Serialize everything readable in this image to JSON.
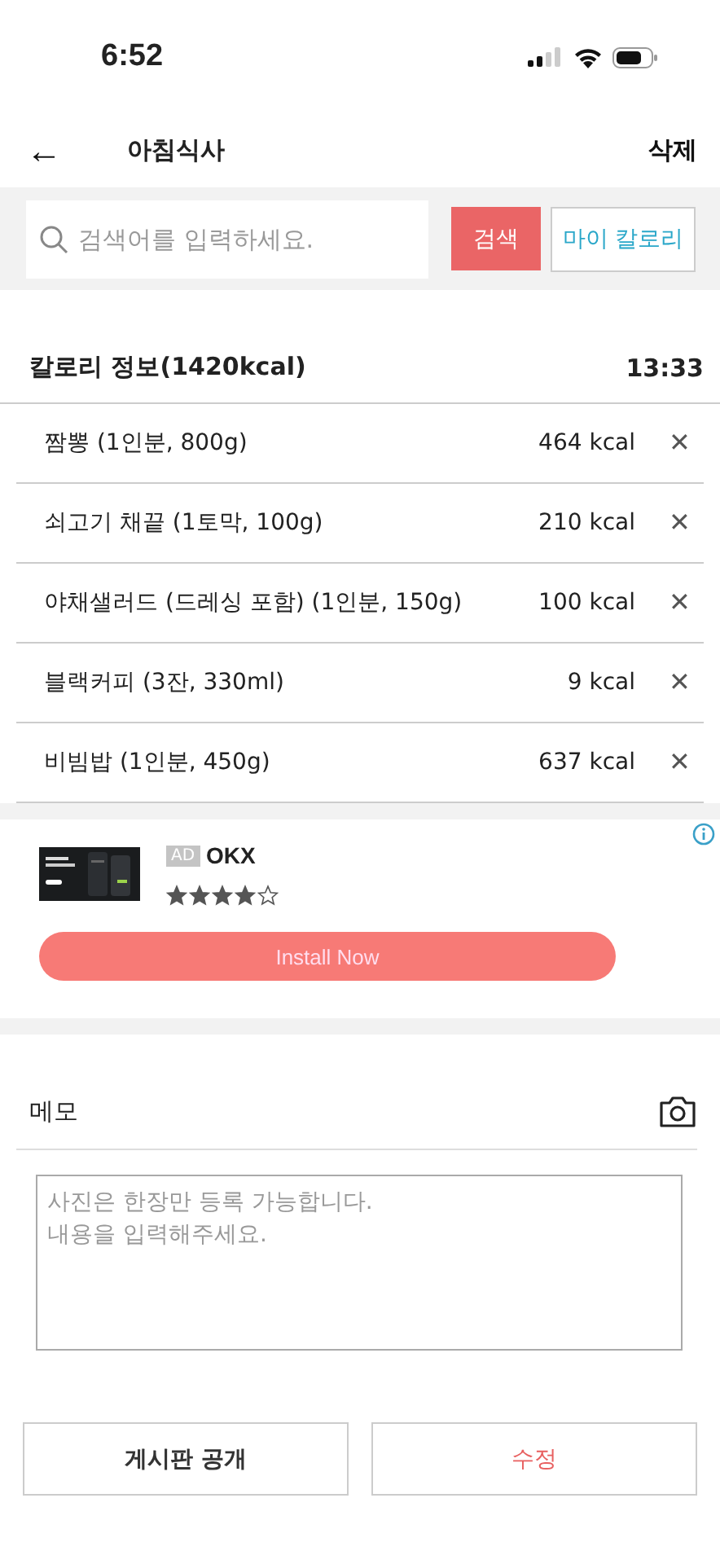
{
  "status_bar": {
    "time": "6:52"
  },
  "header": {
    "back": "←",
    "title": "아침식사",
    "action": "삭제"
  },
  "search": {
    "placeholder": "검색어를 입력하세요.",
    "button": "검색",
    "my_calorie": "마이 칼로리"
  },
  "calorie_info": {
    "title": "칼로리 정보(1420kcal)",
    "time": "13:33",
    "remove": "✕",
    "items": [
      {
        "name": "짬뽕 (1인분, 800g)",
        "kcal": "464 kcal"
      },
      {
        "name": "쇠고기 채끝 (1토막, 100g)",
        "kcal": "210 kcal"
      },
      {
        "name": "야채샐러드 (드레싱 포함) (1인분, 150g)",
        "kcal": "100 kcal"
      },
      {
        "name": "블랙커피 (3잔, 330ml)",
        "kcal": "9 kcal"
      },
      {
        "name": "비빔밥 (1인분, 450g)",
        "kcal": "637 kcal"
      }
    ]
  },
  "ad": {
    "badge": "AD",
    "name": "OKX",
    "stars": 4,
    "button": "Install Now"
  },
  "memo": {
    "title": "메모",
    "placeholder": "사진은 한장만 등록 가능합니다.\n내용을 입력해주세요."
  },
  "buttons": [
    {
      "label": "게시판 공개",
      "kind": "plain"
    },
    {
      "label": "수정",
      "kind": "accent"
    }
  ]
}
